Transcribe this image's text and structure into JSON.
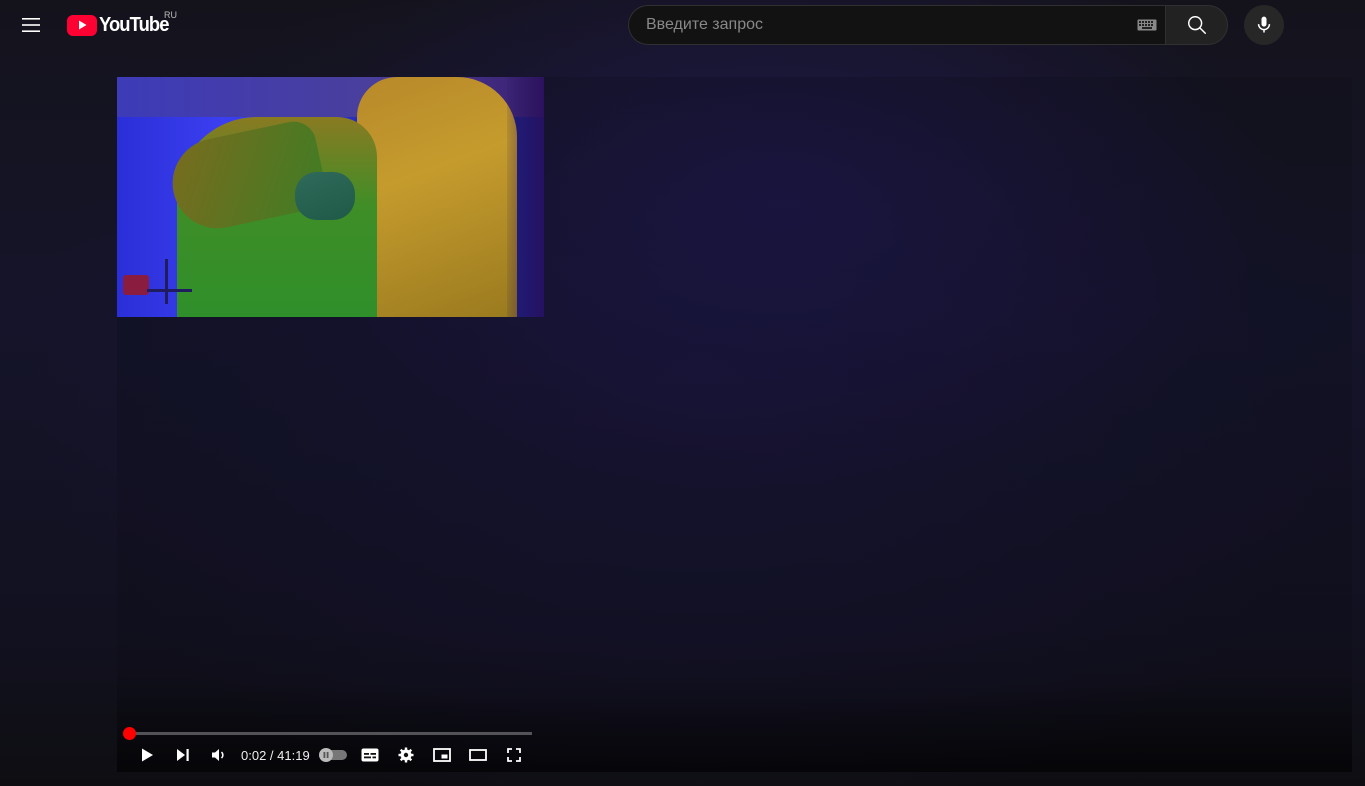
{
  "masthead": {
    "menu_icon": "hamburger-menu-icon",
    "logo_text": "YouTube",
    "logo_country": "RU",
    "search": {
      "placeholder": "Введите запрос",
      "value": "",
      "keyboard_icon": "keyboard-icon",
      "search_icon": "magnifier-icon"
    },
    "mic_icon": "microphone-icon"
  },
  "player": {
    "time_current": "0:02",
    "time_separator": " / ",
    "time_total": "41:19",
    "progress_fraction": 0.0008,
    "autoplay_on": false,
    "controls": [
      {
        "name": "play-button",
        "icon": "play-icon"
      },
      {
        "name": "next-button",
        "icon": "next-track-icon"
      },
      {
        "name": "volume-button",
        "icon": "speaker-icon"
      }
    ],
    "right_controls": [
      {
        "name": "subtitles-button",
        "icon": "subtitles-icon"
      },
      {
        "name": "settings-button",
        "icon": "gear-icon"
      },
      {
        "name": "miniplayer-button",
        "icon": "miniplayer-icon"
      },
      {
        "name": "theater-mode-button",
        "icon": "theater-icon"
      },
      {
        "name": "fullscreen-button",
        "icon": "fullscreen-icon"
      }
    ]
  },
  "colors": {
    "brand_red": "#ff0033",
    "progress_red": "#ff0000",
    "background": "#111018"
  }
}
